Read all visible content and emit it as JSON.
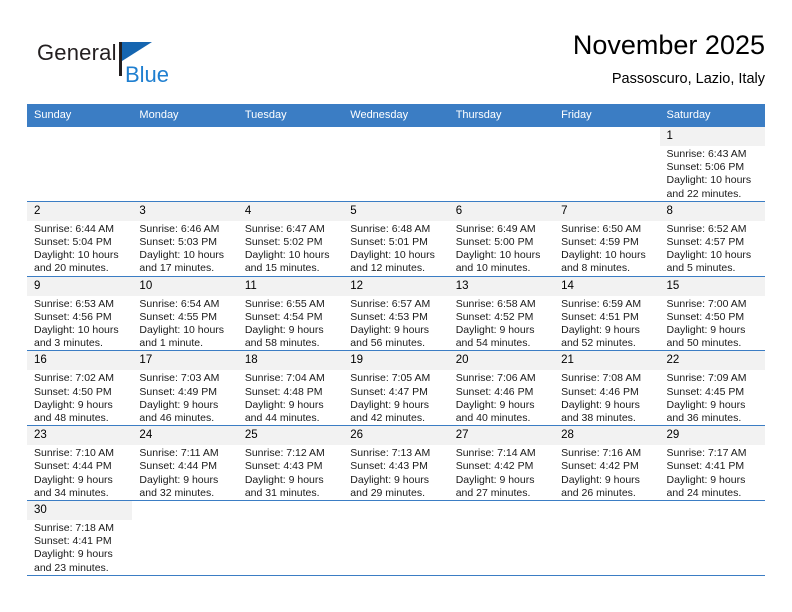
{
  "brand": {
    "name_top": "General",
    "name_bottom": "Blue",
    "flag_icon": "triangle-flag-icon",
    "color_dark": "#231f20",
    "color_blue": "#1f7fd0"
  },
  "header": {
    "title": "November 2025",
    "subtitle": "Passoscuro, Lazio, Italy"
  },
  "theme": {
    "header_bg": "#3b7dc4",
    "row_border": "#3b7dc4",
    "daynum_bg": "#f2f2f2",
    "text": "#000000"
  },
  "calendar": {
    "weekday_headers": [
      "Sunday",
      "Monday",
      "Tuesday",
      "Wednesday",
      "Thursday",
      "Friday",
      "Saturday"
    ],
    "labels": {
      "sunrise": "Sunrise:",
      "sunset": "Sunset:",
      "daylight": "Daylight:"
    },
    "weeks": [
      [
        {
          "blank": true
        },
        {
          "blank": true
        },
        {
          "blank": true
        },
        {
          "blank": true
        },
        {
          "blank": true
        },
        {
          "blank": true
        },
        {
          "day": "1",
          "sunrise": "Sunrise: 6:43 AM",
          "sunset": "Sunset: 5:06 PM",
          "daylight": "Daylight: 10 hours and 22 minutes."
        }
      ],
      [
        {
          "day": "2",
          "sunrise": "Sunrise: 6:44 AM",
          "sunset": "Sunset: 5:04 PM",
          "daylight": "Daylight: 10 hours and 20 minutes."
        },
        {
          "day": "3",
          "sunrise": "Sunrise: 6:46 AM",
          "sunset": "Sunset: 5:03 PM",
          "daylight": "Daylight: 10 hours and 17 minutes."
        },
        {
          "day": "4",
          "sunrise": "Sunrise: 6:47 AM",
          "sunset": "Sunset: 5:02 PM",
          "daylight": "Daylight: 10 hours and 15 minutes."
        },
        {
          "day": "5",
          "sunrise": "Sunrise: 6:48 AM",
          "sunset": "Sunset: 5:01 PM",
          "daylight": "Daylight: 10 hours and 12 minutes."
        },
        {
          "day": "6",
          "sunrise": "Sunrise: 6:49 AM",
          "sunset": "Sunset: 5:00 PM",
          "daylight": "Daylight: 10 hours and 10 minutes."
        },
        {
          "day": "7",
          "sunrise": "Sunrise: 6:50 AM",
          "sunset": "Sunset: 4:59 PM",
          "daylight": "Daylight: 10 hours and 8 minutes."
        },
        {
          "day": "8",
          "sunrise": "Sunrise: 6:52 AM",
          "sunset": "Sunset: 4:57 PM",
          "daylight": "Daylight: 10 hours and 5 minutes."
        }
      ],
      [
        {
          "day": "9",
          "sunrise": "Sunrise: 6:53 AM",
          "sunset": "Sunset: 4:56 PM",
          "daylight": "Daylight: 10 hours and 3 minutes."
        },
        {
          "day": "10",
          "sunrise": "Sunrise: 6:54 AM",
          "sunset": "Sunset: 4:55 PM",
          "daylight": "Daylight: 10 hours and 1 minute."
        },
        {
          "day": "11",
          "sunrise": "Sunrise: 6:55 AM",
          "sunset": "Sunset: 4:54 PM",
          "daylight": "Daylight: 9 hours and 58 minutes."
        },
        {
          "day": "12",
          "sunrise": "Sunrise: 6:57 AM",
          "sunset": "Sunset: 4:53 PM",
          "daylight": "Daylight: 9 hours and 56 minutes."
        },
        {
          "day": "13",
          "sunrise": "Sunrise: 6:58 AM",
          "sunset": "Sunset: 4:52 PM",
          "daylight": "Daylight: 9 hours and 54 minutes."
        },
        {
          "day": "14",
          "sunrise": "Sunrise: 6:59 AM",
          "sunset": "Sunset: 4:51 PM",
          "daylight": "Daylight: 9 hours and 52 minutes."
        },
        {
          "day": "15",
          "sunrise": "Sunrise: 7:00 AM",
          "sunset": "Sunset: 4:50 PM",
          "daylight": "Daylight: 9 hours and 50 minutes."
        }
      ],
      [
        {
          "day": "16",
          "sunrise": "Sunrise: 7:02 AM",
          "sunset": "Sunset: 4:50 PM",
          "daylight": "Daylight: 9 hours and 48 minutes."
        },
        {
          "day": "17",
          "sunrise": "Sunrise: 7:03 AM",
          "sunset": "Sunset: 4:49 PM",
          "daylight": "Daylight: 9 hours and 46 minutes."
        },
        {
          "day": "18",
          "sunrise": "Sunrise: 7:04 AM",
          "sunset": "Sunset: 4:48 PM",
          "daylight": "Daylight: 9 hours and 44 minutes."
        },
        {
          "day": "19",
          "sunrise": "Sunrise: 7:05 AM",
          "sunset": "Sunset: 4:47 PM",
          "daylight": "Daylight: 9 hours and 42 minutes."
        },
        {
          "day": "20",
          "sunrise": "Sunrise: 7:06 AM",
          "sunset": "Sunset: 4:46 PM",
          "daylight": "Daylight: 9 hours and 40 minutes."
        },
        {
          "day": "21",
          "sunrise": "Sunrise: 7:08 AM",
          "sunset": "Sunset: 4:46 PM",
          "daylight": "Daylight: 9 hours and 38 minutes."
        },
        {
          "day": "22",
          "sunrise": "Sunrise: 7:09 AM",
          "sunset": "Sunset: 4:45 PM",
          "daylight": "Daylight: 9 hours and 36 minutes."
        }
      ],
      [
        {
          "day": "23",
          "sunrise": "Sunrise: 7:10 AM",
          "sunset": "Sunset: 4:44 PM",
          "daylight": "Daylight: 9 hours and 34 minutes."
        },
        {
          "day": "24",
          "sunrise": "Sunrise: 7:11 AM",
          "sunset": "Sunset: 4:44 PM",
          "daylight": "Daylight: 9 hours and 32 minutes."
        },
        {
          "day": "25",
          "sunrise": "Sunrise: 7:12 AM",
          "sunset": "Sunset: 4:43 PM",
          "daylight": "Daylight: 9 hours and 31 minutes."
        },
        {
          "day": "26",
          "sunrise": "Sunrise: 7:13 AM",
          "sunset": "Sunset: 4:43 PM",
          "daylight": "Daylight: 9 hours and 29 minutes."
        },
        {
          "day": "27",
          "sunrise": "Sunrise: 7:14 AM",
          "sunset": "Sunset: 4:42 PM",
          "daylight": "Daylight: 9 hours and 27 minutes."
        },
        {
          "day": "28",
          "sunrise": "Sunrise: 7:16 AM",
          "sunset": "Sunset: 4:42 PM",
          "daylight": "Daylight: 9 hours and 26 minutes."
        },
        {
          "day": "29",
          "sunrise": "Sunrise: 7:17 AM",
          "sunset": "Sunset: 4:41 PM",
          "daylight": "Daylight: 9 hours and 24 minutes."
        }
      ],
      [
        {
          "day": "30",
          "sunrise": "Sunrise: 7:18 AM",
          "sunset": "Sunset: 4:41 PM",
          "daylight": "Daylight: 9 hours and 23 minutes."
        },
        {
          "blank": true
        },
        {
          "blank": true
        },
        {
          "blank": true
        },
        {
          "blank": true
        },
        {
          "blank": true
        },
        {
          "blank": true
        }
      ]
    ]
  }
}
